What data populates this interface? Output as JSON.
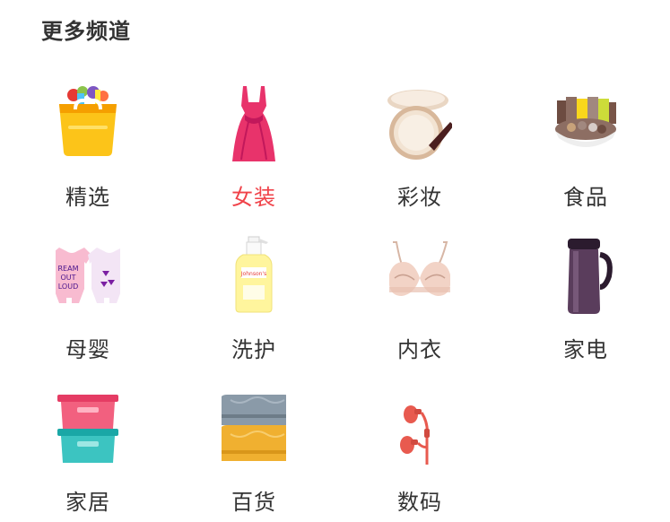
{
  "header": {
    "title": "更多频道"
  },
  "theme": {
    "text_color": "#333333",
    "active_color": "#f0434a",
    "background": "#ffffff"
  },
  "channels": [
    {
      "label": "精选",
      "icon": "shopping-basket-icon",
      "active": false
    },
    {
      "label": "女装",
      "icon": "dress-icon",
      "active": true
    },
    {
      "label": "彩妆",
      "icon": "cushion-compact-icon",
      "active": false
    },
    {
      "label": "食品",
      "icon": "snack-bowl-icon",
      "active": false
    },
    {
      "label": "母婴",
      "icon": "baby-onesie-icon",
      "active": false
    },
    {
      "label": "洗护",
      "icon": "lotion-bottle-icon",
      "active": false
    },
    {
      "label": "内衣",
      "icon": "bra-icon",
      "active": false
    },
    {
      "label": "家电",
      "icon": "soymilk-maker-icon",
      "active": false
    },
    {
      "label": "家居",
      "icon": "storage-box-icon",
      "active": false
    },
    {
      "label": "百货",
      "icon": "towel-stack-icon",
      "active": false
    },
    {
      "label": "数码",
      "icon": "earphones-icon",
      "active": false
    }
  ]
}
